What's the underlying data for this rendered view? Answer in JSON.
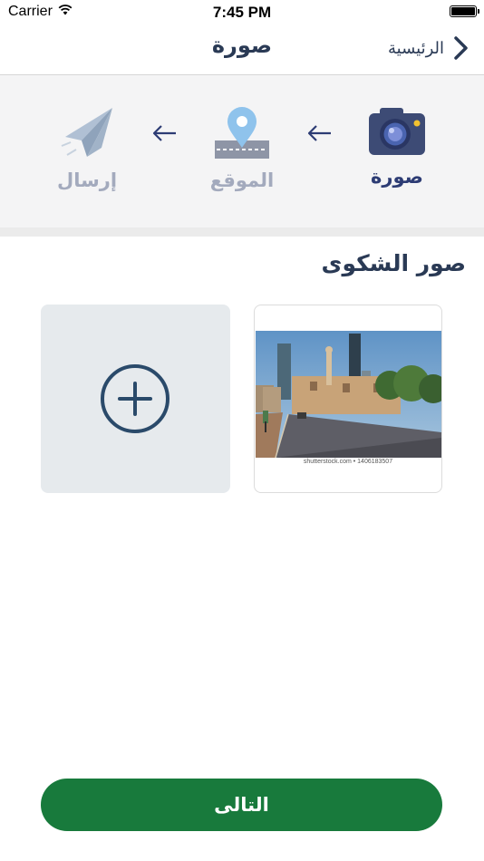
{
  "status_bar": {
    "carrier": "Carrier",
    "time": "7:45 PM"
  },
  "nav": {
    "title": "صورة",
    "back_label": "الرئيسية"
  },
  "steps": [
    {
      "label": "صورة",
      "icon": "camera-icon",
      "state": "active"
    },
    {
      "label": "الموقع",
      "icon": "location-pin-icon",
      "state": "inactive"
    },
    {
      "label": "إرسال",
      "icon": "paper-plane-icon",
      "state": "inactive"
    }
  ],
  "section": {
    "title": "صور الشكوى",
    "photo_caption": "shutterstock.com • 1406183507"
  },
  "next_button": {
    "label": "التالى"
  },
  "colors": {
    "primary": "#2a3a55",
    "active_step": "#2d3c74",
    "inactive_step": "#a3aabd",
    "button_green": "#187a3c",
    "add_tile": "#e6eaed"
  }
}
